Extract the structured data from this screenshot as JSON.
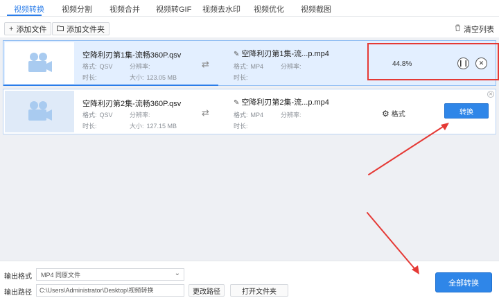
{
  "tabs": [
    {
      "label": "视频转换"
    },
    {
      "label": "视频分割"
    },
    {
      "label": "视频合并"
    },
    {
      "label": "视频转GIF"
    },
    {
      "label": "视频去水印"
    },
    {
      "label": "视频优化"
    },
    {
      "label": "视频截图"
    }
  ],
  "toolbar": {
    "add_file": "添加文件",
    "add_folder": "添加文件夹",
    "clear_list": "清空列表"
  },
  "items": [
    {
      "source_name": "空降利刃第1集-流畅360P.qsv",
      "format_label": "格式:",
      "format_value": "QSV",
      "resolution_label": "分辨率:",
      "resolution_value": "",
      "duration_label": "时长:",
      "duration_value": "",
      "size_label": "大小:",
      "size_value": "123.05 MB",
      "output_name": "空降利刃第1集-流...p.mp4",
      "out_format_label": "格式:",
      "out_format_value": "MP4",
      "out_resolution_label": "分辨率:",
      "out_duration_label": "时长:",
      "progress_text": "44.8%",
      "progress_value": 44.8
    },
    {
      "source_name": "空降利刃第2集-流畅360P.qsv",
      "format_label": "格式:",
      "format_value": "QSV",
      "resolution_label": "分辨率:",
      "resolution_value": "",
      "duration_label": "时长:",
      "duration_value": "",
      "size_label": "大小:",
      "size_value": "127.15 MB",
      "output_name": "空降利刃第2集-流...p.mp4",
      "out_format_label": "格式:",
      "out_format_value": "MP4",
      "out_resolution_label": "分辨率:",
      "out_duration_label": "时长:",
      "format_button": "格式",
      "convert_button": "转换"
    }
  ],
  "bottom": {
    "output_format_label": "输出格式",
    "output_format_value": "MP4  同原文件",
    "output_path_label": "输出路径",
    "output_path_value": "C:\\Users\\Administrator\\Desktop\\视频转换",
    "change_path": "更改路径",
    "open_folder": "打开文件夹",
    "convert_all": "全部转换"
  },
  "colors": {
    "accent": "#2b7de9",
    "highlight_red": "#e53935",
    "list_bg": "#eef0f4"
  }
}
